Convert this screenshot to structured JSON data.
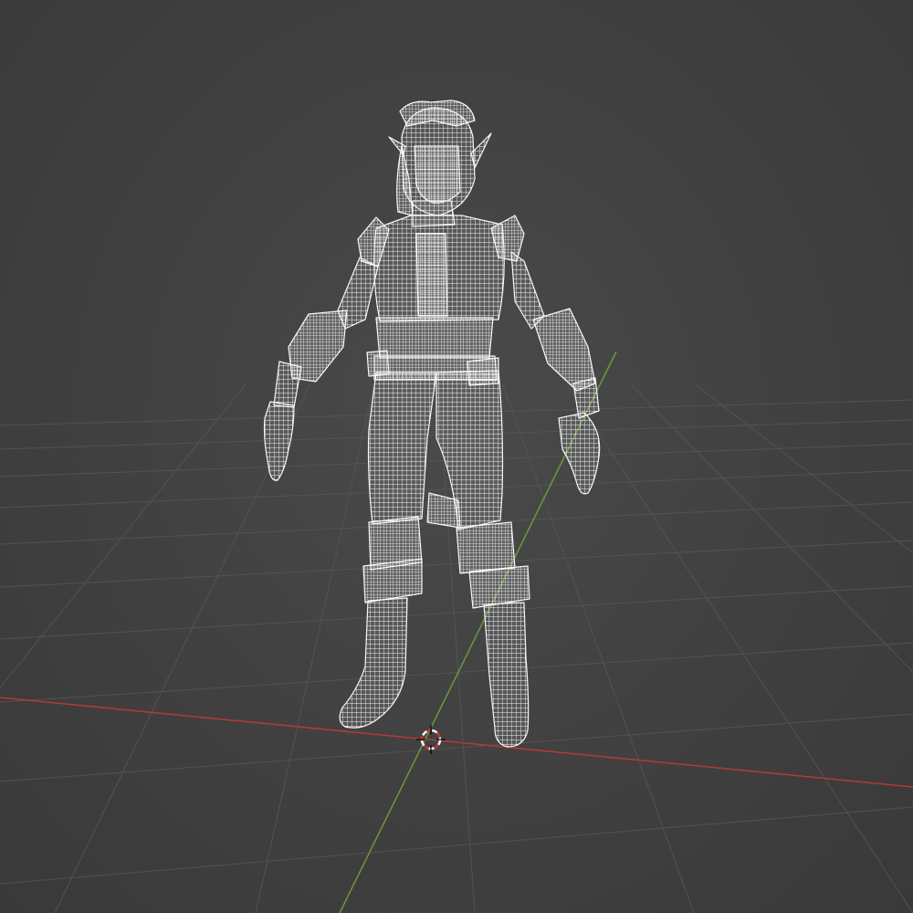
{
  "viewport": {
    "mode": "wireframe",
    "background_color": "#444444",
    "grid_color": "#5a5a5a",
    "x_axis_color": "#b43a3a",
    "y_axis_color": "#6a9a3a",
    "wireframe_color": "#f2f2f2"
  },
  "scene": {
    "object": "character-model",
    "cursor": "3d-cursor-icon"
  }
}
